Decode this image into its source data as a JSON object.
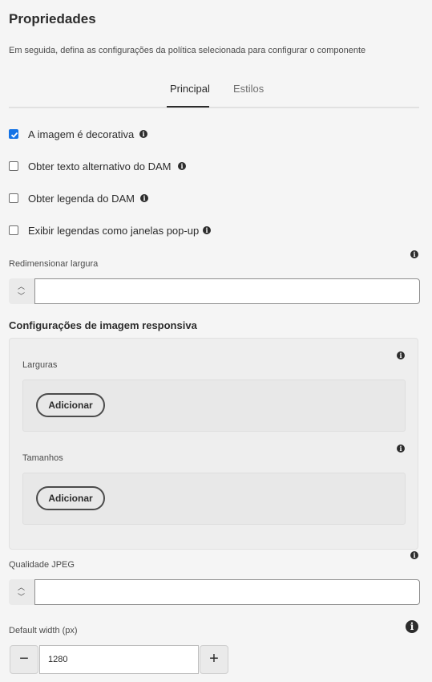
{
  "header": {
    "title": "Propriedades",
    "subtitle": "Em seguida, defina as configurações da política selecionada para configurar o componente"
  },
  "tabs": [
    {
      "label": "Principal",
      "active": true
    },
    {
      "label": "Estilos",
      "active": false
    }
  ],
  "checkboxes": [
    {
      "label": "A imagem é decorativa",
      "checked": true
    },
    {
      "label": "Obter texto alternativo do DAM",
      "checked": false
    },
    {
      "label": "Obter legenda do DAM",
      "checked": false
    },
    {
      "label": "Exibir legendas como janelas pop-up",
      "checked": false
    }
  ],
  "resize_width": {
    "label": "Redimensionar largura",
    "value": ""
  },
  "responsive": {
    "title": "Configurações de imagem responsiva",
    "widths": {
      "label": "Larguras",
      "add_label": "Adicionar"
    },
    "sizes": {
      "label": "Tamanhos",
      "add_label": "Adicionar"
    }
  },
  "jpeg_quality": {
    "label": "Qualidade JPEG",
    "value": ""
  },
  "default_width": {
    "label": "Default width (px)",
    "value": "1280",
    "minus_label": "−",
    "plus_label": "+"
  },
  "icons": {
    "info": "info-icon",
    "check": "checkmark-icon",
    "chevron_up": "chevron-up-icon",
    "chevron_down": "chevron-down-icon"
  },
  "colors": {
    "accent": "#1473e6",
    "text": "#2c2c2c",
    "background": "#f5f5f5"
  }
}
